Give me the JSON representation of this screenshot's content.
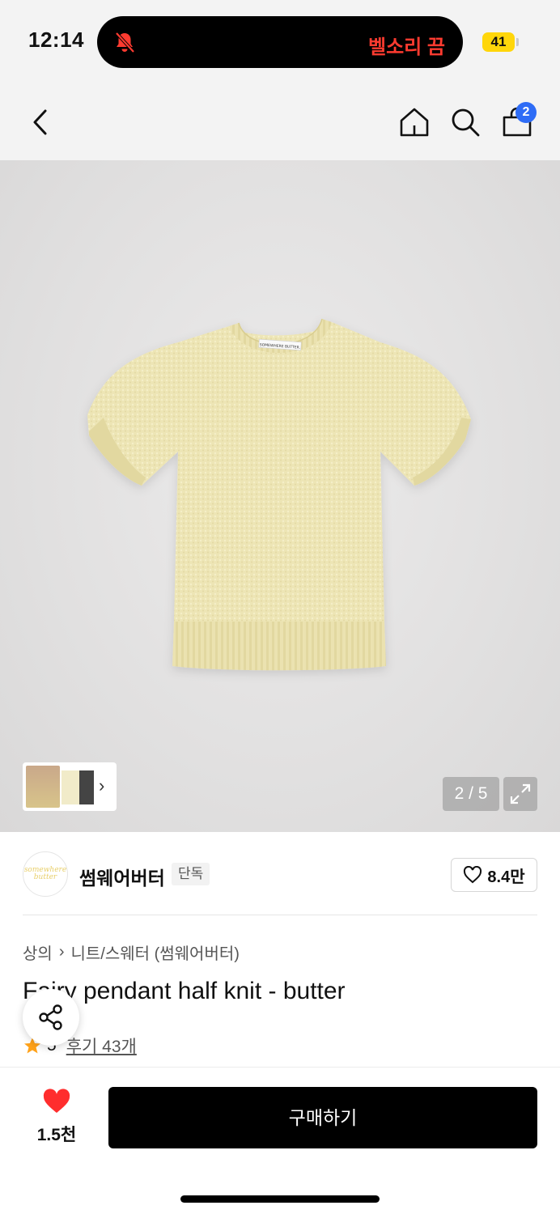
{
  "status_bar": {
    "time": "12:14",
    "silent_label": "벨소리 끔",
    "battery": "41"
  },
  "navbar": {
    "cart_count": "2"
  },
  "gallery": {
    "counter": "2 / 5",
    "image_alt": "SOMEWHERE BUTTER knit top"
  },
  "brand": {
    "name": "썸웨어버터",
    "tag": "단독",
    "logo_text": "somewhere butter",
    "likes": "8.4만"
  },
  "product": {
    "breadcrumb": [
      "상의",
      "니트/스웨터 (썸웨어버터)"
    ],
    "title": "Fairy pendant half knit - butter",
    "rating": "5",
    "reviews": "후기 43개"
  },
  "bottom": {
    "wish_count": "1.5천",
    "buy_label": "구매하기"
  },
  "colors": {
    "accent_badge": "#2e6cf6",
    "heart": "#ff2d2d",
    "star": "#ffa21a",
    "silent_red": "#ff3b30"
  }
}
